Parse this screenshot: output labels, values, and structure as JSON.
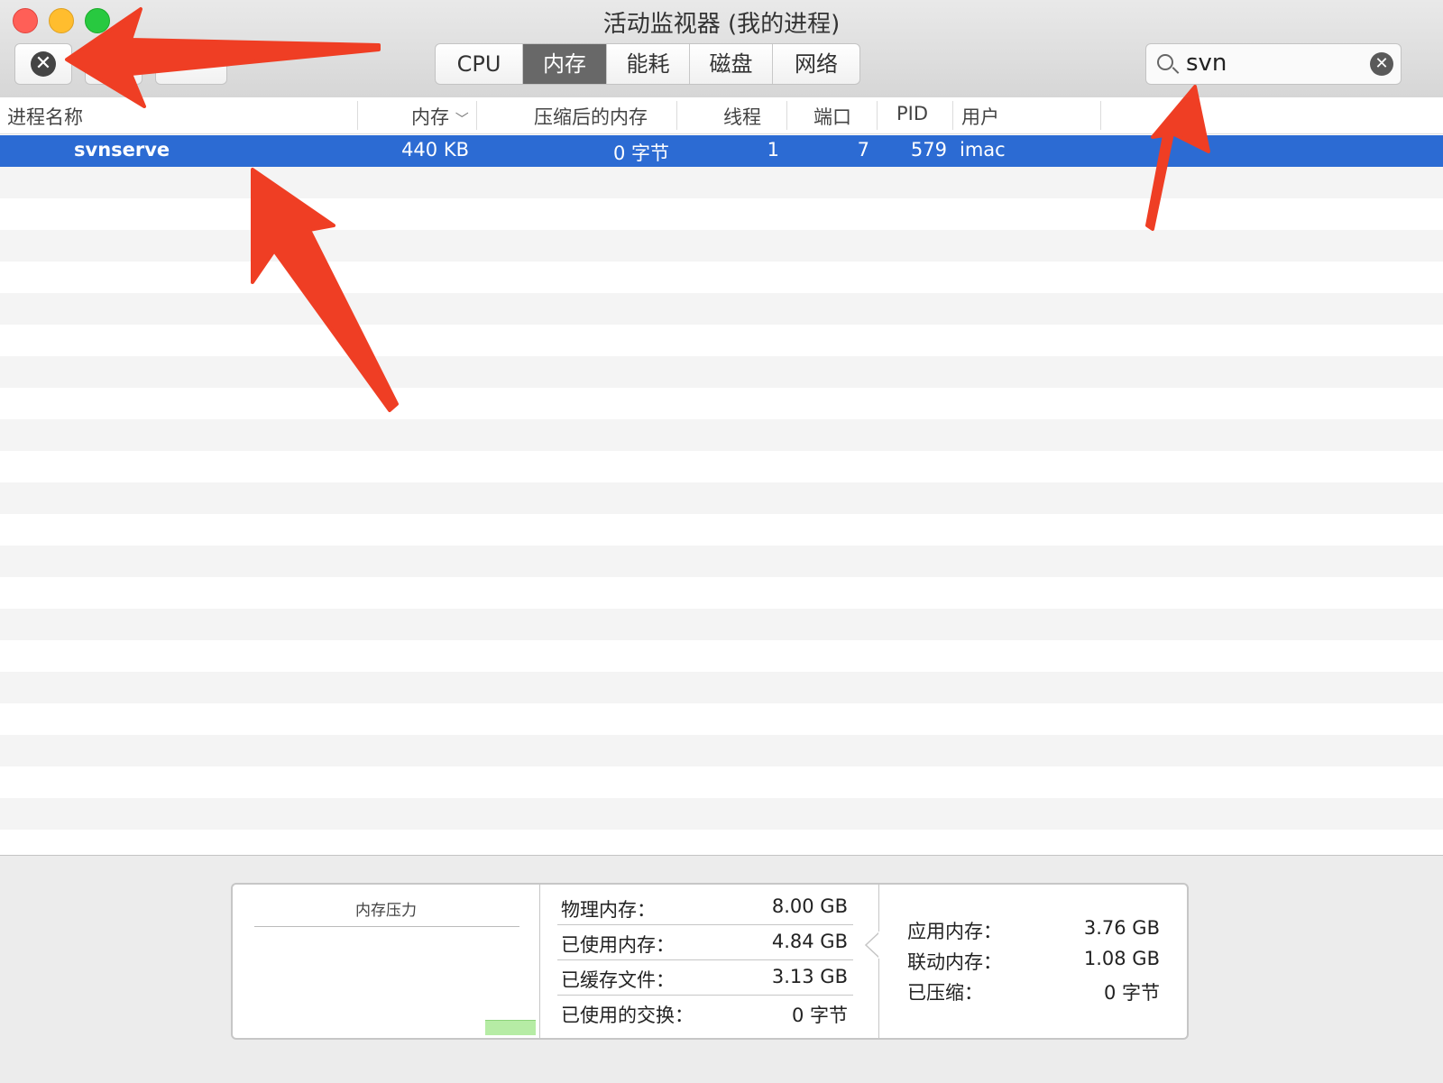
{
  "window": {
    "title": "活动监视器 (我的进程)"
  },
  "toolbar": {
    "tabs": [
      {
        "label": "CPU",
        "active": false
      },
      {
        "label": "内存",
        "active": true
      },
      {
        "label": "能耗",
        "active": false
      },
      {
        "label": "磁盘",
        "active": false
      },
      {
        "label": "网络",
        "active": false
      }
    ],
    "search": {
      "value": "svn"
    }
  },
  "table": {
    "headers": [
      "进程名称",
      "内存",
      "压缩后的内存",
      "线程",
      "端口",
      "PID",
      "用户"
    ],
    "rows": [
      {
        "name": "svnserve",
        "memory": "440 KB",
        "compressed": "0 字节",
        "threads": "1",
        "ports": "7",
        "pid": "579",
        "user": "imac"
      }
    ]
  },
  "memory_panel": {
    "pressure_title": "内存压力",
    "stats": [
      {
        "label": "物理内存：",
        "value": "8.00 GB"
      },
      {
        "label": "已使用内存：",
        "value": "4.84 GB"
      },
      {
        "label": "已缓存文件：",
        "value": "3.13 GB"
      },
      {
        "label": "已使用的交换：",
        "value": "0 字节"
      }
    ],
    "details": [
      {
        "label": "应用内存：",
        "value": "3.76 GB"
      },
      {
        "label": "联动内存：",
        "value": "1.08 GB"
      },
      {
        "label": "已压缩：",
        "value": "0 字节"
      }
    ]
  },
  "colors": {
    "selection": "#2c6bd3",
    "annotation": "#ef3e24",
    "pressure": "#b6eca5"
  }
}
